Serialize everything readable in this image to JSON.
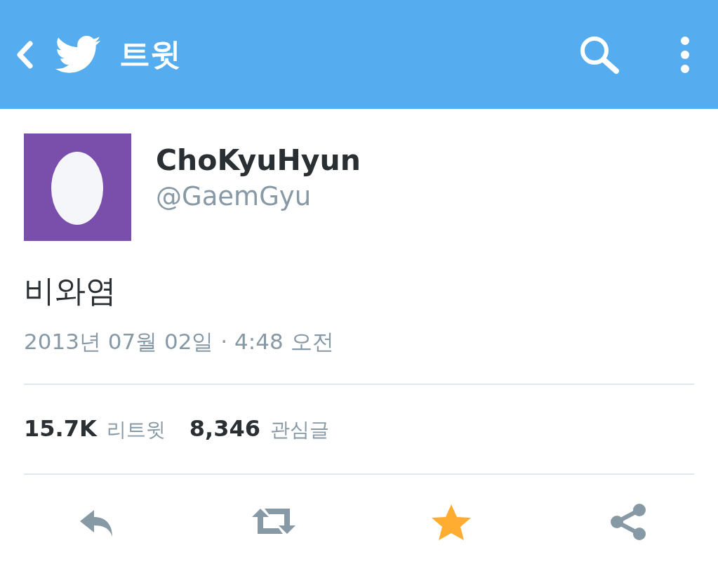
{
  "app_bar": {
    "title": "트윗"
  },
  "tweet": {
    "name": "ChoKyuHyun",
    "handle": "@GaemGyu",
    "text": "비와염",
    "timestamp": "2013년 07월 02일 · 4:48 오전"
  },
  "stats": [
    {
      "count": "15.7K",
      "label": "리트윗"
    },
    {
      "count": "8,346",
      "label": "관심글"
    }
  ],
  "actions": [
    {
      "kind": "reply",
      "selected": false
    },
    {
      "kind": "retweet",
      "selected": false
    },
    {
      "kind": "favorite",
      "selected": true
    },
    {
      "kind": "share",
      "selected": false
    }
  ]
}
